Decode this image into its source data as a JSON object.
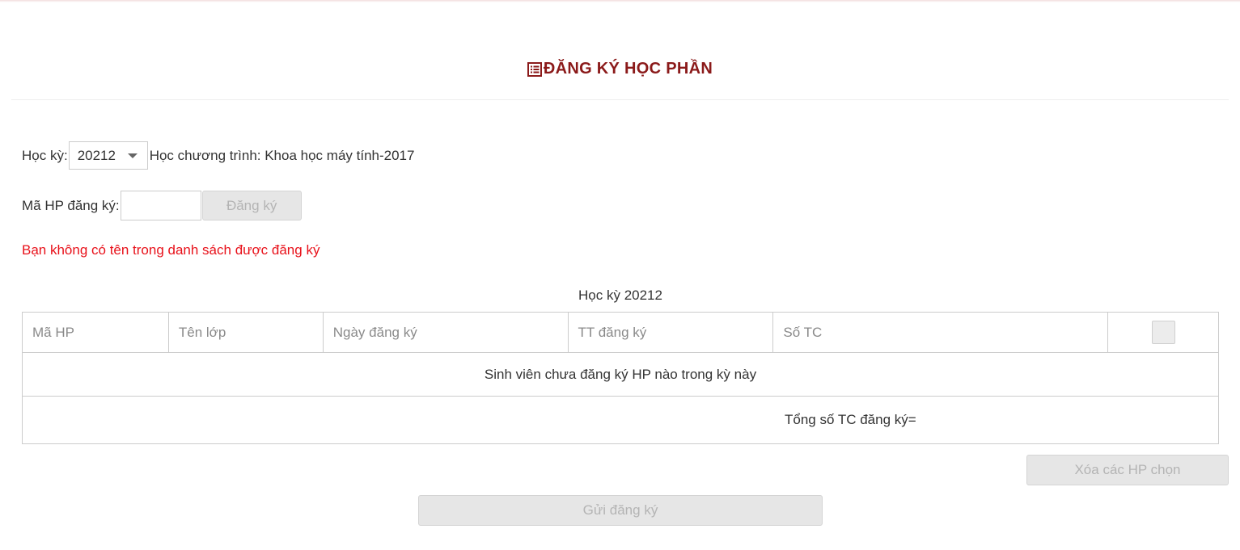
{
  "page": {
    "title": "ĐĂNG KÝ HỌC PHẦN",
    "title_icon": "list-icon",
    "accent_color": "#8b1a1a",
    "warning_color": "#e8111a"
  },
  "semester_row": {
    "label": "Học kỳ:",
    "selected_semester": "20212",
    "program_text": "Học chương trình: Khoa học máy tính-2017"
  },
  "register_row": {
    "label": "Mã HP đăng ký:",
    "input_value": "",
    "button_label": "Đăng ký"
  },
  "warning_message": "Bạn không có tên trong danh sách được đăng ký",
  "table": {
    "caption": "Học kỳ 20212",
    "columns": [
      "Mã HP",
      "Tên lớp",
      "Ngày đăng ký",
      "TT đăng ký",
      "Số TC"
    ],
    "empty_message": "Sinh viên chưa đăng ký HP nào trong kỳ này",
    "total_label": "Tổng số TC đăng ký="
  },
  "actions": {
    "delete_selected_label": "Xóa các HP chọn",
    "submit_label": "Gửi đăng ký"
  }
}
